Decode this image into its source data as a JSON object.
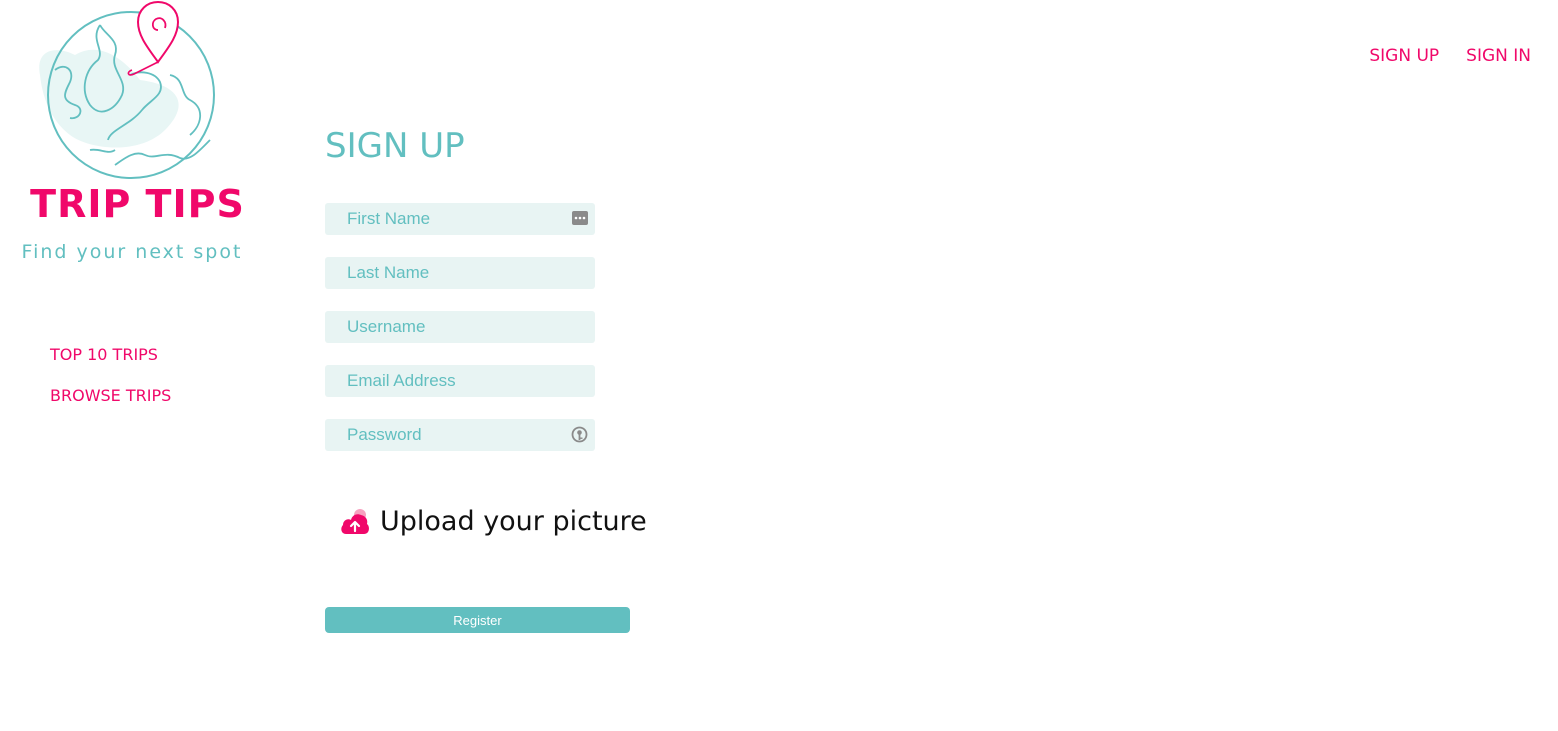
{
  "brand": {
    "title": "TRIP TIPS",
    "tagline": "Find your next spot",
    "colors": {
      "accent": "#f0086a",
      "teal": "#62bfc0",
      "field_bg": "#e8f4f3"
    }
  },
  "top_nav": {
    "sign_up": "SIGN UP",
    "sign_in": "SIGN IN"
  },
  "side_nav": {
    "items": [
      {
        "label": "TOP 10 TRIPS"
      },
      {
        "label": "BROWSE TRIPS"
      }
    ]
  },
  "form": {
    "title": "SIGN UP",
    "fields": [
      {
        "placeholder": "First Name",
        "value": ""
      },
      {
        "placeholder": "Last Name",
        "value": ""
      },
      {
        "placeholder": "Username",
        "value": ""
      },
      {
        "placeholder": "Email Address",
        "value": ""
      },
      {
        "placeholder": "Password",
        "value": ""
      }
    ],
    "upload_label": "Upload your picture",
    "register_label": "Register"
  },
  "icons": [
    "globe-pin-logo-icon",
    "autofill-dots-icon",
    "password-key-icon",
    "cloud-upload-icon"
  ]
}
